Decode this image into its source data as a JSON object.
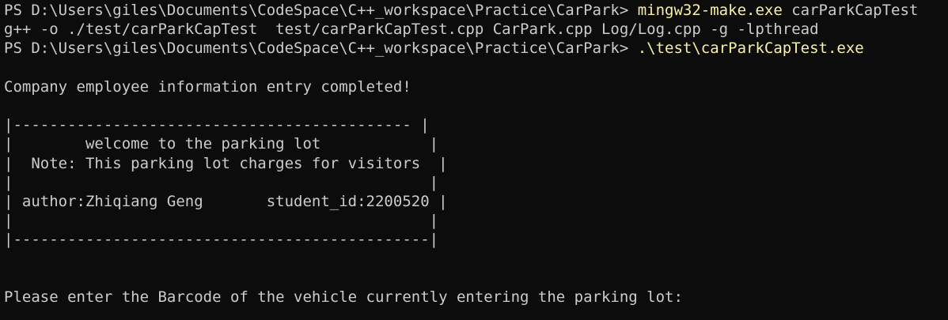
{
  "terminal": {
    "lines": [
      {
        "prompt": "PS D:\\Users\\giles\\Documents\\CodeSpace\\C++_workspace\\Practice\\CarPark> ",
        "cmd": "mingw32-make.exe",
        "args": " carParkCapTest"
      },
      {
        "text": "g++ -o ./test/carParkCapTest  test/carParkCapTest.cpp CarPark.cpp Log/Log.cpp -g -lpthread"
      },
      {
        "prompt": "PS D:\\Users\\giles\\Documents\\CodeSpace\\C++_workspace\\Practice\\CarPark> ",
        "cmd": ".\\test\\carParkCapTest.exe",
        "args": ""
      },
      {
        "text": ""
      },
      {
        "text": "Company employee information entry completed!"
      },
      {
        "text": ""
      },
      {
        "text": "|-------------------------------------------- |"
      },
      {
        "text": "|        welcome to the parking lot            |"
      },
      {
        "text": "|  Note: This parking lot charges for visitors  |"
      },
      {
        "text": "|                                              |"
      },
      {
        "text": "| author:Zhiqiang Geng       student_id:2200520 |"
      },
      {
        "text": "|                                              |"
      },
      {
        "text": "|----------------------------------------------|"
      },
      {
        "text": ""
      },
      {
        "text": ""
      },
      {
        "text": "Please enter the Barcode of the vehicle currently entering the parking lot:"
      }
    ]
  }
}
